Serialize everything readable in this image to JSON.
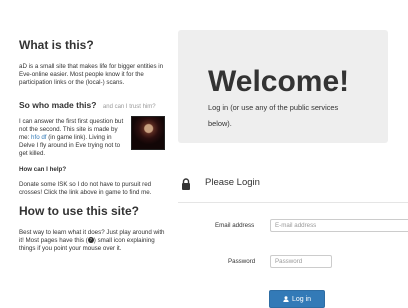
{
  "about": {
    "title": "What is this?",
    "description": "aD is a small site that makes life for bigger entities in Eve-online easier. Most people know it for the participation links or the (local-) scans."
  },
  "who": {
    "title": "So who made this?",
    "aside": "and can I trust him?",
    "text_before": "I can answer the first first question but not the second. This site is made by me: ",
    "author_link": "hfo df",
    "text_after": " (in game link). Living in Delve I fly around in Eve trying not to get killed."
  },
  "help": {
    "title": "How can I help?",
    "text": "Donate some ISK so I do not have to pursuit red crosses! Click the link above in game to find me."
  },
  "howto": {
    "title": "How to use this site?",
    "text_before": "Best way to learn what it does? Just play around with it! Most pages have this (",
    "text_after": ") small icon explaining things if you point your mouse over it."
  },
  "jumbotron": {
    "heading": "Welcome!",
    "lead": "Log in (or use any of the public services below)."
  },
  "login": {
    "title": "Please Login",
    "email_label": "Email address",
    "email_placeholder": "E-mail address",
    "password_label": "Password",
    "password_placeholder": "Password",
    "submit_label": "Log in"
  },
  "colors": {
    "primary": "#337ab7",
    "jumbotron_bg": "#eeeeee",
    "muted": "#999999"
  },
  "icons": [
    "info-icon",
    "lock-icon",
    "user-icon"
  ]
}
